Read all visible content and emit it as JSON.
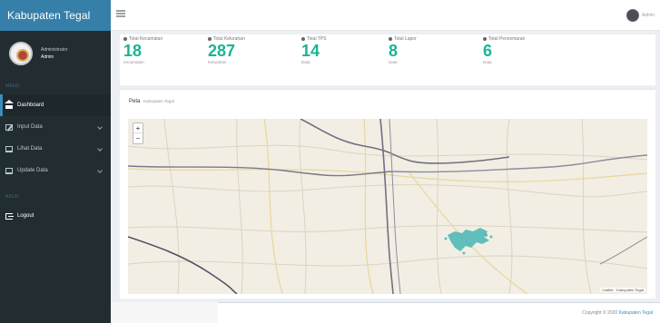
{
  "brand": {
    "title": "Kabupaten Tegal"
  },
  "user": {
    "name": "Administrator",
    "role": "Admin"
  },
  "sidebar": {
    "section_main": "MENU",
    "items": [
      {
        "label": "Dashboard",
        "icon": "home-icon",
        "active": true
      },
      {
        "label": "Input Data",
        "icon": "edit-icon",
        "active": false
      },
      {
        "label": "Lihat Data",
        "icon": "monitor-icon",
        "active": false
      },
      {
        "label": "Update Data",
        "icon": "monitor-icon",
        "active": false
      }
    ],
    "section_account": "AKUN",
    "logout_label": "Logout"
  },
  "topbar": {
    "user_name": "Admin"
  },
  "stats": [
    {
      "label": "Total Kecamatan",
      "value": "18",
      "sub": "Kecamatan"
    },
    {
      "label": "Total Kelurahan",
      "value": "287",
      "sub": "Kelurahan"
    },
    {
      "label": "Total TPS",
      "value": "14",
      "sub": "Data"
    },
    {
      "label": "Total Lapor",
      "value": "8",
      "sub": "Data"
    },
    {
      "label": "Total Pencemaran",
      "value": "6",
      "sub": "Data"
    }
  ],
  "map": {
    "title": "Peta",
    "subtitle": "Kabupaten Tegal",
    "zoom_in": "+",
    "zoom_out": "−",
    "attribution": "Leaflet · Kabupaten Tegal"
  },
  "footer": {
    "text": "Copyright © 2020",
    "link": "Kabupaten Tegal"
  },
  "colors": {
    "accent": "#1ab394",
    "sidebar": "#222d32",
    "brand": "#367fa9",
    "map_polygon": "#46b5b5"
  }
}
